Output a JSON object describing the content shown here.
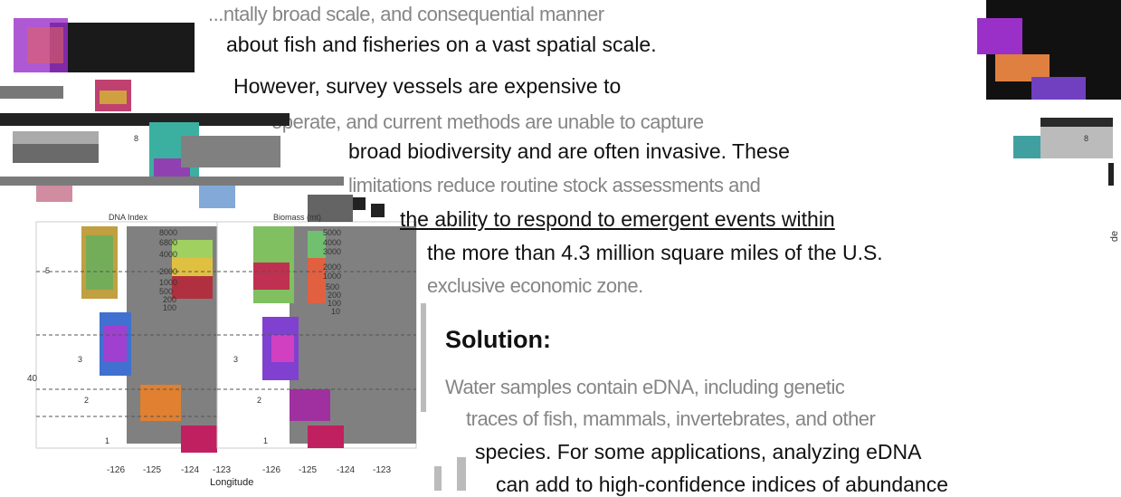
{
  "maps": {
    "left": {
      "label": "DNA Index",
      "ticks": [
        "8000",
        "6800",
        "4000",
        "2000",
        "1000",
        "500",
        "200",
        "100"
      ]
    },
    "right": {
      "label": "Biomass (mt)",
      "ticks": [
        "5000",
        "4000",
        "3000",
        "2000",
        "1000",
        "500",
        "200",
        "100",
        "10"
      ]
    },
    "xaxis_title": "Longitude",
    "xticks": [
      "-126",
      "-125",
      "-124",
      "-123"
    ],
    "yticks": [
      "40"
    ],
    "zones": [
      "8",
      "5",
      "3",
      "2",
      "1"
    ],
    "right_edge_label": "de"
  },
  "colors": {
    "gray_land": "#808080",
    "dark_fill": "#1a1a1a",
    "accent_purple": "#9a30c8"
  },
  "text": {
    "line1": "...ntally broad scale, and consequential manner",
    "line2": "about fish and fisheries on a vast spatial scale.",
    "line3": "However, survey vessels are expensive to",
    "line4": "operate, and current methods are unable to capture",
    "line5": "broad biodiversity and are often invasive. These",
    "line6": "limitations reduce routine stock assessments and",
    "line7": "the ability to respond to emergent events within",
    "line8": "the more than 4.3 million square miles of the U.S.",
    "line9": "exclusive economic zone.",
    "solution_heading": "Solution:",
    "sol1": "Water samples contain eDNA, including genetic",
    "sol2": "traces of fish, mammals, invertebrates, and other",
    "sol3": "species. For some applications, analyzing eDNA",
    "sol4": "can add to high-confidence indices of abundance"
  }
}
